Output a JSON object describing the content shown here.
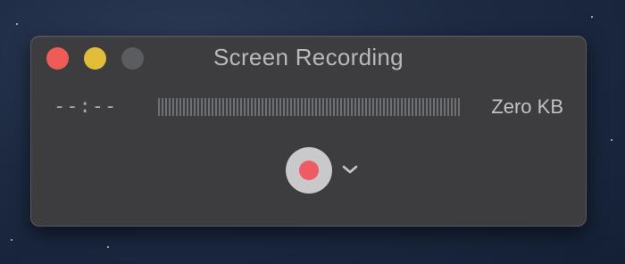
{
  "window": {
    "title": "Screen Recording",
    "controls": [
      "close",
      "minimize",
      "zoom"
    ]
  },
  "status": {
    "elapsed_time": "--:--",
    "file_size": "Zero KB"
  },
  "controls": {
    "record_icon": "record-icon",
    "options_icon": "chevron-down-icon"
  },
  "colors": {
    "close": "#ee5c58",
    "minimize": "#e2bd3a",
    "zoom_disabled": "#5b5c5f",
    "record": "#ef5b63",
    "window_bg": "#3d3d40"
  }
}
